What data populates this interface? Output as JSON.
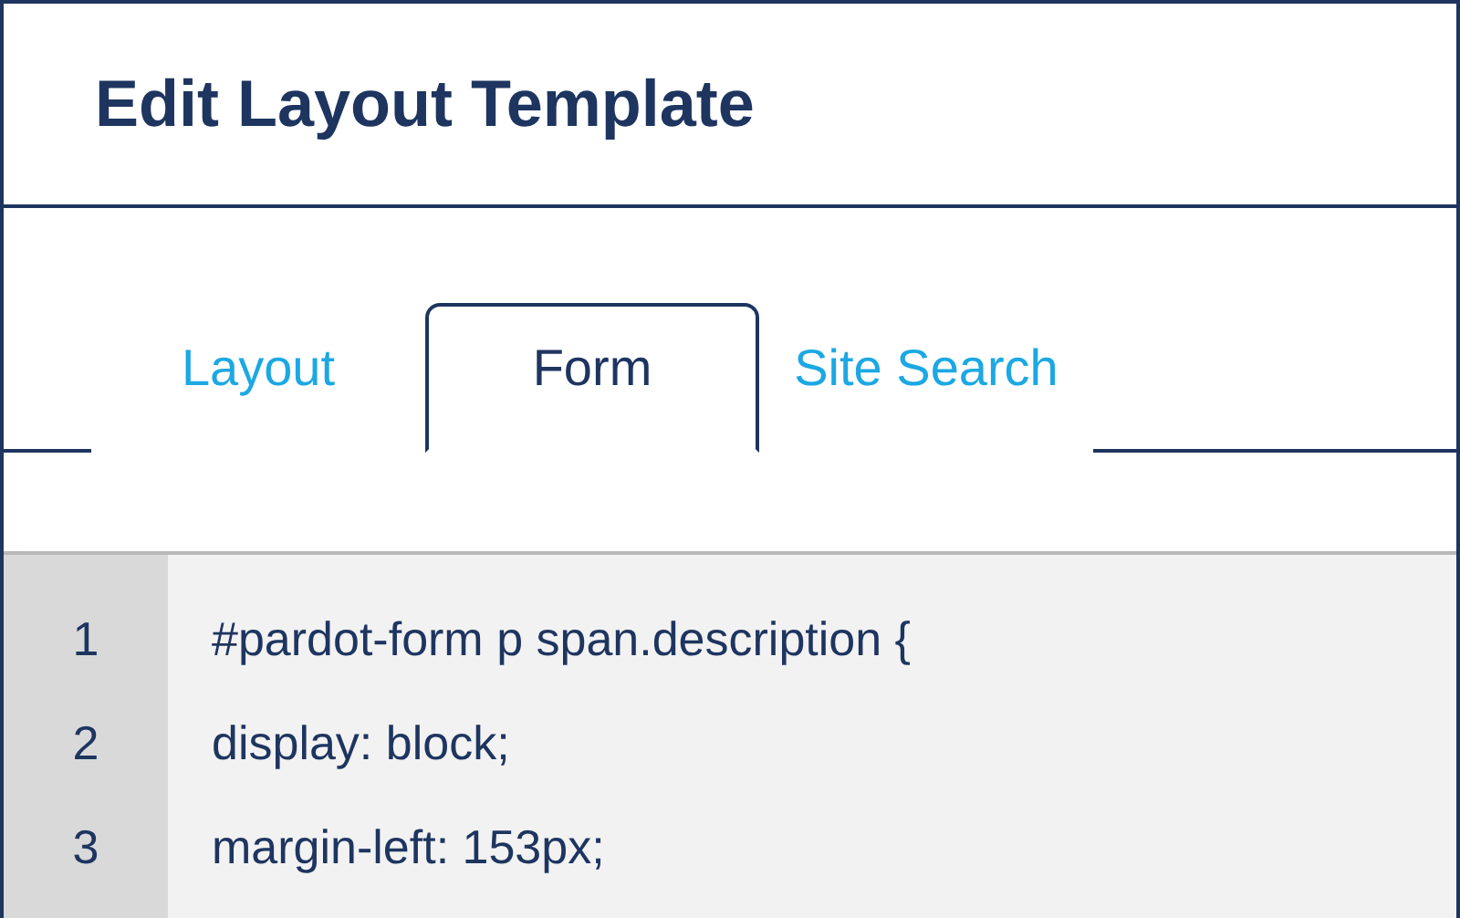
{
  "header": {
    "title": "Edit Layout Template"
  },
  "tabs": [
    {
      "label": "Layout",
      "selected": false
    },
    {
      "label": "Form",
      "selected": true
    },
    {
      "label": "Site Search",
      "selected": false
    }
  ],
  "editor": {
    "lines": [
      {
        "number": "1",
        "code": "#pardot-form p span.description {"
      },
      {
        "number": "2",
        "code": "display: block;"
      },
      {
        "number": "3",
        "code": "margin-left: 153px;"
      }
    ]
  }
}
